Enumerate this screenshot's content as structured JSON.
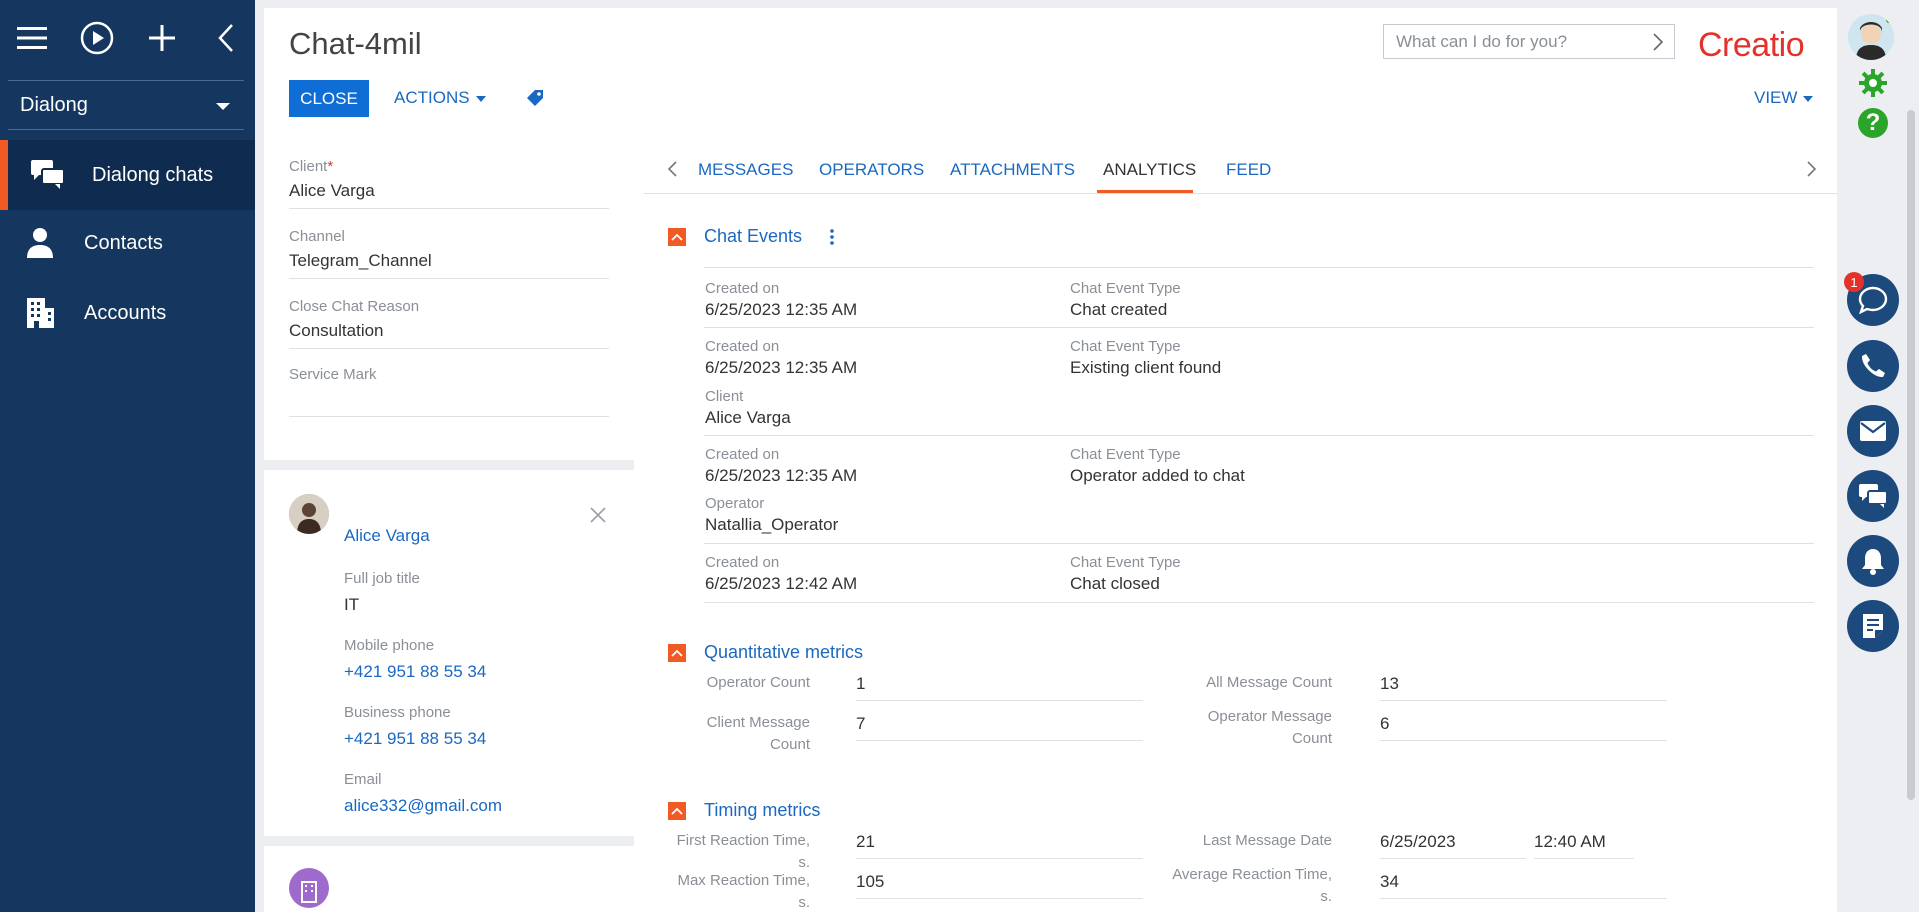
{
  "sidebar": {
    "workspace": "Dialong",
    "items": [
      {
        "label": "Dialong chats",
        "icon": "chat-bubbles-icon",
        "active": true
      },
      {
        "label": "Contacts",
        "icon": "person-icon",
        "active": false
      },
      {
        "label": "Accounts",
        "icon": "building-icon",
        "active": false
      }
    ]
  },
  "header": {
    "title": "Chat-4mil",
    "close_label": "CLOSE",
    "actions_label": "ACTIONS",
    "view_label": "VIEW",
    "search_placeholder": "What can I do for you?",
    "logo_text": "Creatio"
  },
  "chat_fields": [
    {
      "label": "Client",
      "value": "Alice Varga",
      "required": true
    },
    {
      "label": "Channel",
      "value": "Telegram_Channel",
      "required": false
    },
    {
      "label": "Close Chat Reason",
      "value": "Consultation",
      "required": false
    },
    {
      "label": "Service Mark",
      "value": "",
      "required": false
    }
  ],
  "contact": {
    "name": "Alice Varga",
    "fields": [
      {
        "label": "Full job title",
        "value": "IT",
        "link": false
      },
      {
        "label": "Mobile phone",
        "value": "+421 951 88 55 34",
        "link": true
      },
      {
        "label": "Business phone",
        "value": "+421 951 88 55 34",
        "link": true
      },
      {
        "label": "Email",
        "value": "alice332@gmail.com",
        "link": true
      }
    ]
  },
  "tabs": [
    {
      "label": "MESSAGES",
      "active": false
    },
    {
      "label": "OPERATORS",
      "active": false
    },
    {
      "label": "ATTACHMENTS",
      "active": false
    },
    {
      "label": "ANALYTICS",
      "active": true
    },
    {
      "label": "FEED",
      "active": false
    }
  ],
  "chat_events": {
    "title": "Chat Events",
    "rows": [
      {
        "created_label": "Created on",
        "created": "6/25/2023 12:35 AM",
        "type_label": "Chat Event Type",
        "type": "Chat created"
      },
      {
        "created_label": "Created on",
        "created": "6/25/2023 12:35 AM",
        "type_label": "Chat Event Type",
        "type": "Existing client found",
        "extra_label": "Client",
        "extra": "Alice Varga"
      },
      {
        "created_label": "Created on",
        "created": "6/25/2023 12:35 AM",
        "type_label": "Chat Event Type",
        "type": "Operator added to chat",
        "extra_label": "Operator",
        "extra": "Natallia_Operator"
      },
      {
        "created_label": "Created on",
        "created": "6/25/2023 12:42 AM",
        "type_label": "Chat Event Type",
        "type": "Chat closed"
      }
    ]
  },
  "quantitative": {
    "title": "Quantitative metrics",
    "operator_count_label": "Operator Count",
    "operator_count": "1",
    "all_message_count_label": "All Message Count",
    "all_message_count": "13",
    "client_message_count_label": "Client Message Count",
    "client_message_count": "7",
    "operator_message_count_label_1": "Operator Message",
    "operator_message_count_label_2": "Count",
    "operator_message_count": "6"
  },
  "timing": {
    "title": "Timing metrics",
    "first_reaction_label": "First Reaction Time, s.",
    "first_reaction": "21",
    "last_message_label": "Last Message Date",
    "last_message_date": "6/25/2023",
    "last_message_time": "12:40 AM",
    "max_reaction_label": "Max Reaction Time, s.",
    "max_reaction": "105",
    "avg_reaction_label_1": "Average Reaction Time,",
    "avg_reaction_label_2": "s.",
    "avg_reaction": "34"
  },
  "communication": {
    "chat_badge": "1",
    "buttons": [
      "chat-icon",
      "phone-icon",
      "email-icon",
      "messages-icon",
      "bell-icon",
      "notes-icon"
    ]
  },
  "colors": {
    "sidebar": "#15375f",
    "accent": "#f15a22",
    "primary": "#0e6ed5",
    "link": "#1b68c2"
  }
}
